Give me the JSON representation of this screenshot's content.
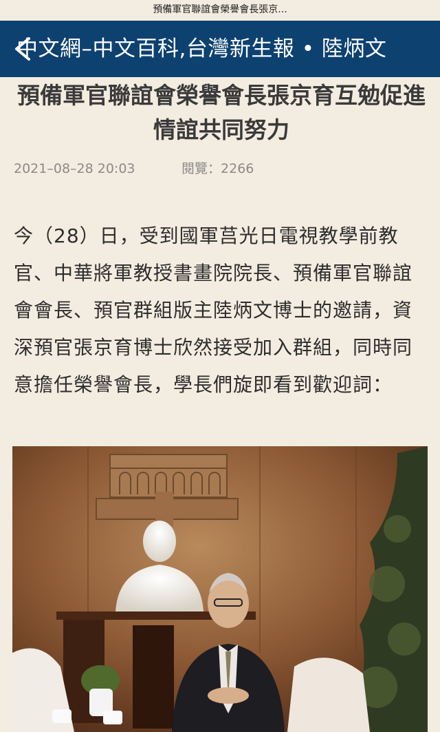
{
  "status_bar": {
    "title": "預備軍官聯誼會榮譽會長張京..."
  },
  "nav": {
    "title": "中文網–中文百科,台灣新生報 • 陸炳文"
  },
  "article": {
    "headline": "預備軍官聯誼會榮譽會長張京育互勉促進情誼共同努力",
    "date": "2021–08–28 20:03",
    "views_label": "閱覽：",
    "views_count": "2266",
    "paragraph": "今（28）日，受到國軍莒光日電視教學前教官、中華將軍教授書畫院院長、預備軍官聯誼會會長、預官群組版主陸炳文博士的邀請，資深預官張京育博士欣然接受加入群組，同時同意擔任榮譽會長，學長們旋即看到歡迎詞："
  },
  "icons": {
    "back": "back-arrow-icon"
  },
  "colors": {
    "nav_bg": "#0d4170",
    "page_bg": "#f3ece0"
  }
}
